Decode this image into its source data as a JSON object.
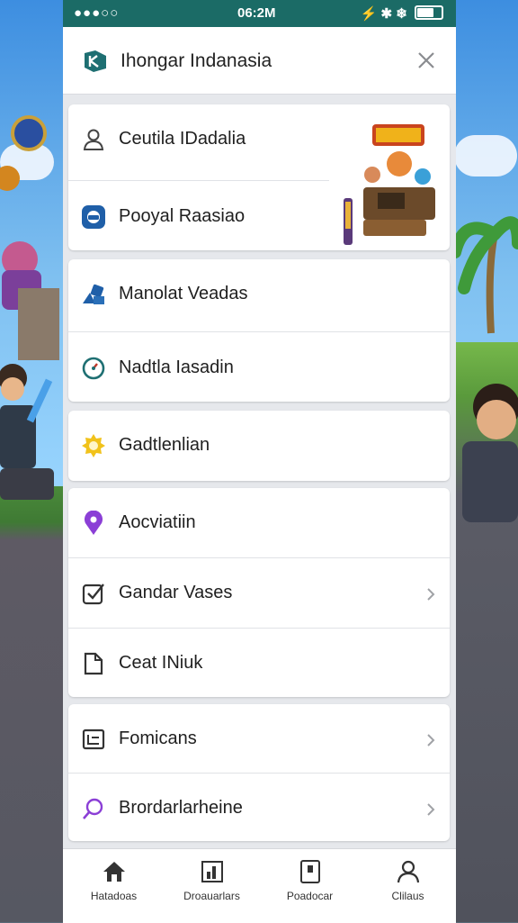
{
  "status_bar": {
    "signal": "●●●○○",
    "time": "06:2M",
    "right_icons": "⚡ ✱ ❄"
  },
  "header": {
    "title": "Ihongar Indanasia",
    "logo_icon": "k-logo-icon",
    "close_icon": "close-icon"
  },
  "menu": {
    "group1": [
      {
        "label": "Ceutila IDadalia",
        "icon": "person-icon"
      },
      {
        "label": "Pooyal Raasiao",
        "icon": "camera-circle-icon"
      }
    ],
    "group2": [
      {
        "label": "Manolat Veadas",
        "icon": "shapes-icon"
      },
      {
        "label": "Nadtla Iasadin",
        "icon": "gauge-icon"
      }
    ],
    "group3": [
      {
        "label": "Gadtlenlian",
        "icon": "star-badge-icon"
      }
    ],
    "group4": [
      {
        "label": "Aocviatiin",
        "icon": "location-pin-icon"
      },
      {
        "label": "Gandar Vases",
        "icon": "checkbox-icon",
        "chevron": true
      },
      {
        "label": "Ceat INiuk",
        "icon": "document-icon"
      }
    ],
    "group5": [
      {
        "label": "Fomicans",
        "icon": "list-box-icon",
        "chevron": true
      },
      {
        "label": "Brordarlarheine",
        "icon": "search-icon",
        "chevron": true
      }
    ]
  },
  "tabs": [
    {
      "label": "Hatadoas",
      "icon": "home-icon"
    },
    {
      "label": "Droauarlars",
      "icon": "chart-icon"
    },
    {
      "label": "Poadocar",
      "icon": "card-icon"
    },
    {
      "label": "Clilaus",
      "icon": "profile-icon"
    }
  ],
  "colors": {
    "status_bar": "#1b6b66",
    "accent_teal": "#1e6f72",
    "accent_purple": "#8b3fd6",
    "accent_yellow": "#f1c21b",
    "accent_blue": "#1f5fa8"
  }
}
